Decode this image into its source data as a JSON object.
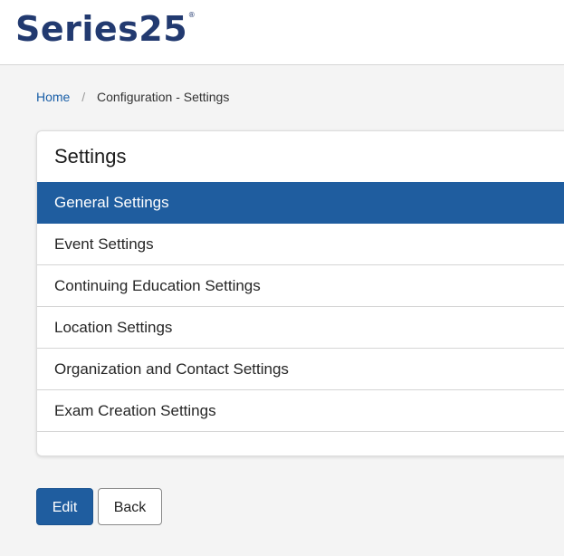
{
  "header": {
    "logo_text": "Series25",
    "logo_mark": "®"
  },
  "breadcrumb": {
    "home": "Home",
    "separator": "/",
    "current": "Configuration - Settings"
  },
  "settings": {
    "title": "Settings",
    "items": [
      {
        "label": "General Settings",
        "active": true
      },
      {
        "label": "Event Settings",
        "active": false
      },
      {
        "label": "Continuing Education Settings",
        "active": false
      },
      {
        "label": "Location Settings",
        "active": false
      },
      {
        "label": "Organization and Contact Settings",
        "active": false
      },
      {
        "label": "Exam Creation Settings",
        "active": false
      }
    ]
  },
  "actions": {
    "edit_label": "Edit",
    "back_label": "Back"
  },
  "colors": {
    "brand": "#223a70",
    "accent": "#1f5d9f",
    "link": "#1a5fa8"
  }
}
